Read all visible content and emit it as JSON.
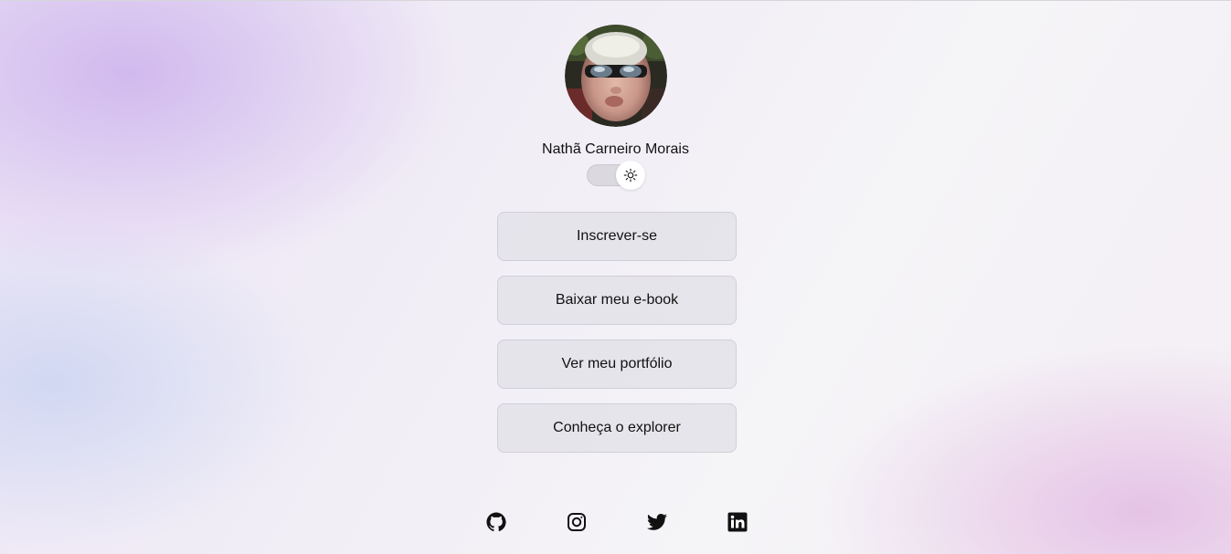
{
  "profile": {
    "name": "Nathã Carneiro Morais",
    "theme_toggle_icon": "sun-icon"
  },
  "links": [
    {
      "label": "Inscrever-se"
    },
    {
      "label": "Baixar meu e-book"
    },
    {
      "label": "Ver meu portfólio"
    },
    {
      "label": "Conheça o explorer"
    }
  ],
  "socials": [
    {
      "icon": "github-icon"
    },
    {
      "icon": "instagram-icon"
    },
    {
      "icon": "twitter-icon"
    },
    {
      "icon": "linkedin-icon"
    }
  ],
  "colors": {
    "text": "#111111",
    "button_bg": "#e1dfe6",
    "accent_gradient": "#c8aaeb"
  }
}
